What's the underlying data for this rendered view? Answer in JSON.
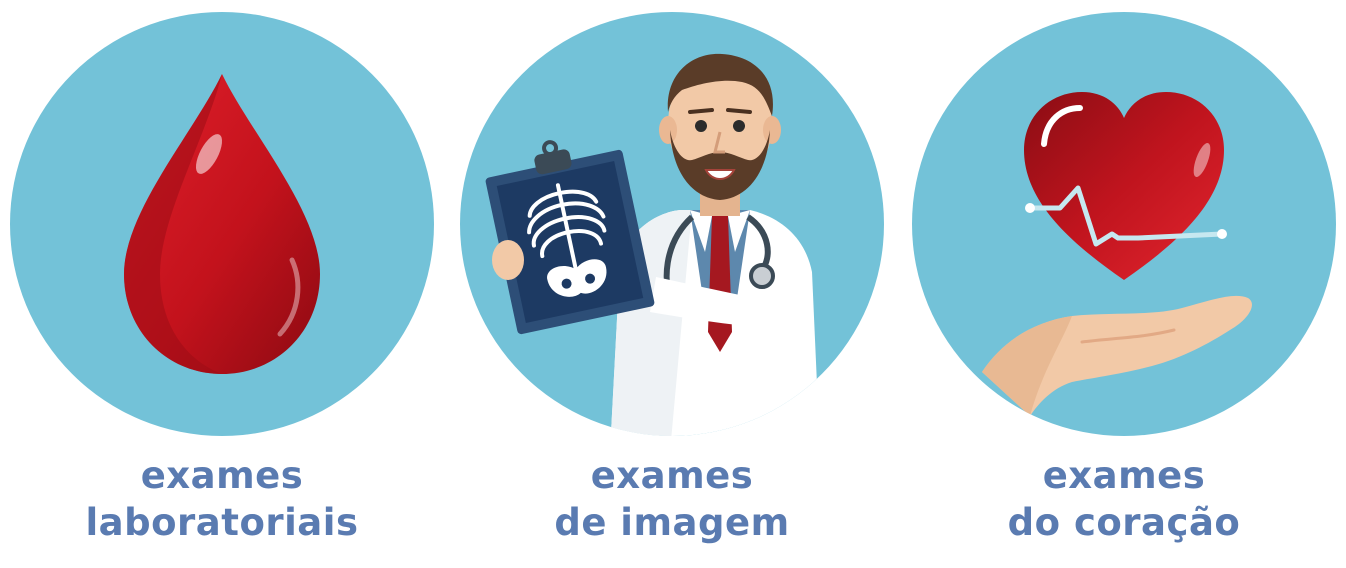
{
  "colors": {
    "circle_bg": "#73c2d8",
    "caption_text": "#5a7bb1",
    "blood_red": "#c3121c",
    "heart_red": "#c0141e",
    "skin": "#f2c9a7",
    "coat": "#ffffff",
    "xray_bg": "#1d3a63"
  },
  "cards": [
    {
      "icon": "blood-drop-icon",
      "line1": "exames",
      "line2": "laboratoriais"
    },
    {
      "icon": "doctor-xray-icon",
      "line1": "exames",
      "line2": "de imagem"
    },
    {
      "icon": "heart-hand-icon",
      "line1": "exames",
      "line2": "do coração"
    }
  ]
}
